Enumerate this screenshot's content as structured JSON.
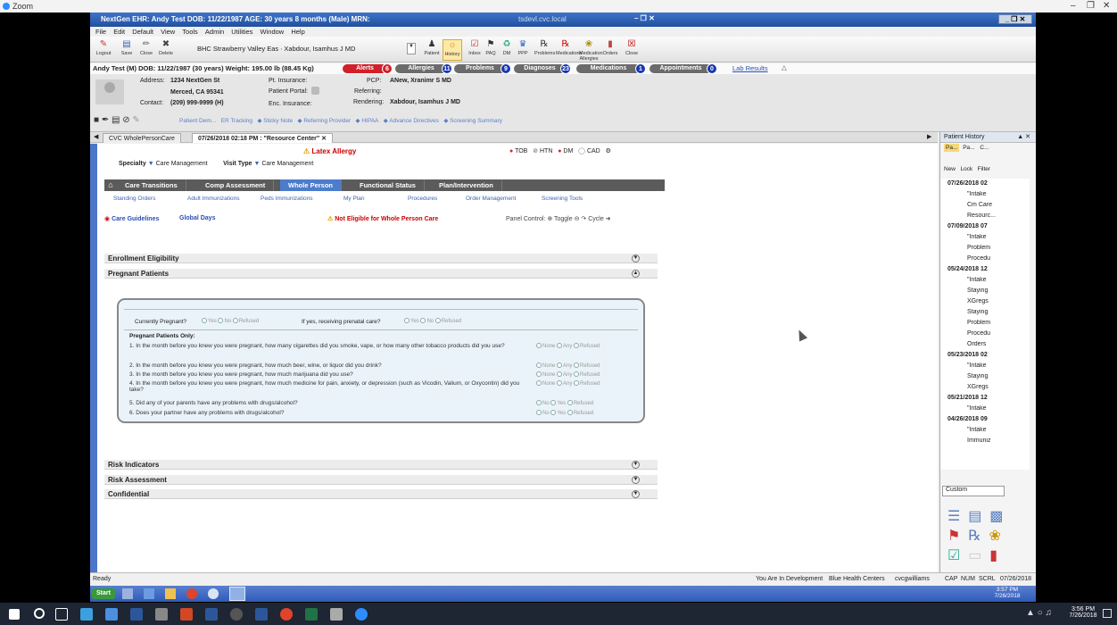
{
  "zoom": {
    "title": "Zoom"
  },
  "window": {
    "title": "NextGen EHR: Andy Test  DOB: 11/22/1987  AGE: 30 years 8 months  (Male)  MRN:",
    "remote_host": "tsdevl.cvc.local"
  },
  "menu": [
    "File",
    "Edit",
    "Default",
    "View",
    "Tools",
    "Admin",
    "Utilities",
    "Window",
    "Help"
  ],
  "toolbar": {
    "buttons_left": [
      "Logout",
      "Save",
      "Close",
      "Delete"
    ],
    "location": "BHC Strawberry Valley Eas ∙ Xabdour, Isamhus J MD",
    "buttons_right": [
      "Patient",
      "History",
      "Inbox",
      "PAQ",
      "DM",
      "PPP",
      "Problems",
      "Medications",
      "Medication Allergies",
      "Orders",
      "Close"
    ]
  },
  "patient": {
    "header": "Andy Test  (M)  DOB:  11/22/1987 (30 years)  Weight:  195.00 lb (88.45 Kg)",
    "address_label": "Address:",
    "address1": "1234 NextGen St",
    "address2": "Merced, CA 95341",
    "contact_label": "Contact:",
    "contact": "(209) 999-9999 (H)",
    "pt_insurance_label": "Pt. Insurance:",
    "portal_label": "Patient Portal:",
    "enc_insurance_label": "Enc. Insurance:",
    "pcp_label": "PCP:",
    "pcp": "ANew, Xranimr S MD",
    "referring_label": "Referring:",
    "rendering_label": "Rendering:",
    "rendering": "Xabdour, Isamhus J MD",
    "links": [
      "Patient Dem...",
      "ER Tracking",
      "◆ Sticky Note",
      "◆ Referring Provider",
      "◆ HIPAA",
      "◆ Advance Directives",
      "◆ Screening Summary"
    ]
  },
  "pills": [
    {
      "label": "Alerts",
      "count": "6",
      "color": "#d0202a"
    },
    {
      "label": "Allergies",
      "count": "11",
      "color": "#6b6b6b"
    },
    {
      "label": "Problems",
      "count": "9",
      "color": "#6b6b6b"
    },
    {
      "label": "Diagnoses",
      "count": "23",
      "color": "#6b6b6b"
    },
    {
      "label": "Medications",
      "count": "1",
      "color": "#6b6b6b"
    },
    {
      "label": "Appointments",
      "count": "0",
      "color": "#6b6b6b"
    }
  ],
  "lab_results": "Lab Results",
  "doc_tabs": [
    {
      "label": "CVC WholePersonCare"
    },
    {
      "label": "07/26/2018 02:18 PM : \"Resource Center\""
    }
  ],
  "template": {
    "latex_allergy": "Latex Allergy",
    "indicators": [
      "TOB",
      "HTN",
      "DM",
      "CAD"
    ],
    "specialty_label": "Specialty",
    "specialty_value": "Care Management",
    "visit_type_label": "Visit Type",
    "visit_type_value": "Care Management",
    "tabs": [
      "Care Transitions",
      "Comp Assessment",
      "Whole Person",
      "Functional Status",
      "Plan/Intervention"
    ],
    "subnav": [
      "Standing Orders",
      "Adult Immunizations",
      "Peds Immunizations",
      "My Plan",
      "Procedures",
      "Order Management",
      "Screening Tools"
    ],
    "care_guidelines": "Care Guidelines",
    "global_days": "Global Days",
    "not_eligible": "Not Eligible for Whole Person Care",
    "panel_control": "Panel Control:",
    "toggle": "Toggle",
    "cycle": "Cycle",
    "sections_top": [
      "Enrollment Eligibility",
      "Pregnant Patients"
    ],
    "sections_bottom": [
      "Risk Indicators",
      "Risk Assessment",
      "Confidential"
    ]
  },
  "form": {
    "currently_pregnant": "Currently Pregnant?",
    "prenatal": "If yes, receiving prenatal care?",
    "yes_no_refused": [
      "Yes",
      "No",
      "Refused"
    ],
    "only_label": "Pregnant Patients Only:",
    "questions": [
      {
        "text": "1.  In the month before you knew you were pregnant, how many cigarettes did you smoke, vape, or how many other tobacco products did you use?",
        "options": [
          "None",
          "Any",
          "Refused"
        ]
      },
      {
        "text": "2.  In the month before you knew you were pregnant, how much beer, wine, or liquor did you drink?",
        "options": [
          "None",
          "Any",
          "Refused"
        ]
      },
      {
        "text": "3.  In the month before you knew you were pregnant, how much marijuana did you use?",
        "options": [
          "None",
          "Any",
          "Refused"
        ]
      },
      {
        "text": "4.  In the month before you knew you were pregnant, how much medicine for pain, anxiety, or depression (such as Vicodin, Valium, or Oxycontin) did you take?",
        "options": [
          "None",
          "Any",
          "Refused"
        ]
      },
      {
        "text": "5.  Did any of your parents have  any problems with drugs/alcohol?",
        "options": [
          "No",
          "Yes",
          "Refused"
        ]
      },
      {
        "text": "6.  Does your partner have any problems with drugs/alcohol?",
        "options": [
          "No",
          "Yes",
          "Refused"
        ]
      }
    ]
  },
  "history": {
    "title": "Patient History",
    "tabs": [
      "Pa...",
      "Pa...",
      "C..."
    ],
    "toolbar": [
      "New",
      "Lock",
      "Filter"
    ],
    "tree": [
      "07/26/2018 02",
      "\"Intake",
      "Cm Care",
      "Resourc...",
      "07/09/2018 07",
      "\"Intake",
      "Problem",
      "Procedu",
      "05/24/2018 12",
      "\"Intake",
      "Staying",
      "XGregs",
      "Staying",
      "Problem",
      "Procedu",
      "Orders",
      "05/23/2018 02",
      "\"Intake",
      "Staying",
      "XGregs",
      "05/21/2018 12",
      "\"Intake",
      "04/26/2018 09",
      "\"Intake",
      "Immuniz"
    ],
    "custom": "Custom"
  },
  "status": {
    "ready": "Ready",
    "env": "You Are In Development",
    "org": "Blue Health Centers",
    "user": "cvcgwilliams",
    "flags": [
      "CAP",
      "NUM",
      "SCRL"
    ],
    "date": "07/26/2018"
  },
  "app_taskbar": {
    "start": "Start",
    "time": "3:57 PM",
    "date": "7/26/2018"
  },
  "win_taskbar": {
    "time": "3:56 PM",
    "date": "7/26/2018"
  }
}
